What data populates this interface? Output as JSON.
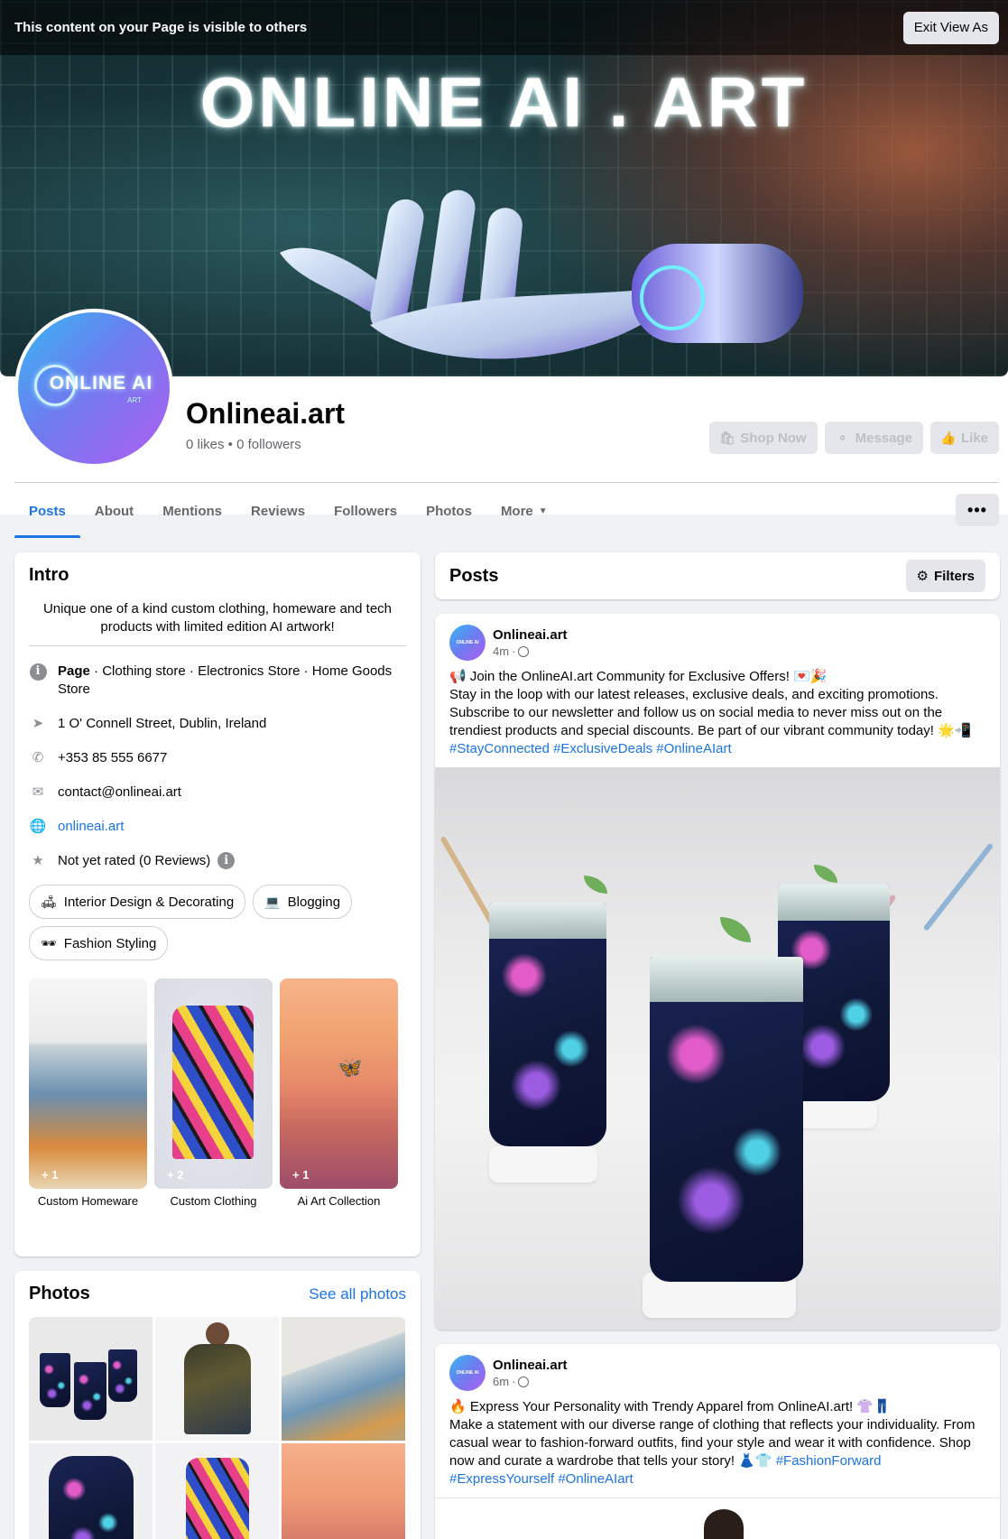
{
  "view_as": {
    "notice": "This content on your Page is visible to others",
    "exit_label": "Exit View As"
  },
  "cover": {
    "logo_text": "ONLINE AI . ART"
  },
  "profile": {
    "avatar_text": "ONLINE AI",
    "avatar_sub": "ART",
    "name": "Onlineai.art",
    "stats": "0 likes • 0 followers",
    "actions": [
      {
        "label": "Shop Now",
        "icon": "bag-icon"
      },
      {
        "label": "Message",
        "icon": "messenger-icon"
      },
      {
        "label": "Like",
        "icon": "thumbs-up-icon"
      }
    ]
  },
  "tabs": [
    {
      "label": "Posts",
      "active": true
    },
    {
      "label": "About"
    },
    {
      "label": "Mentions"
    },
    {
      "label": "Reviews"
    },
    {
      "label": "Followers"
    },
    {
      "label": "Photos"
    },
    {
      "label": "More"
    }
  ],
  "more_menu_label": "•••",
  "intro": {
    "title": "Intro",
    "bio": "Unique one of a kind custom clothing, homeware and tech products with limited edition AI artwork!",
    "page_label": "Page",
    "categories": " · Clothing store · Electronics Store · Home Goods Store",
    "address": "1 O' Connell Street, Dublin, Ireland",
    "phone": "+353 85 555 6677",
    "email": "contact@onlineai.art",
    "website": "onlineai.art",
    "rating": "Not yet rated (0 Reviews)",
    "interests": [
      {
        "label": "Interior Design & Decorating",
        "icon": "sofa-icon"
      },
      {
        "label": "Blogging",
        "icon": "laptop-icon"
      },
      {
        "label": "Fashion Styling",
        "icon": "sunglasses-icon"
      }
    ],
    "featured": [
      {
        "caption": "Custom Homeware",
        "badge": "+ 1"
      },
      {
        "caption": "Custom Clothing",
        "badge": "+ 2"
      },
      {
        "caption": "Ai Art Collection",
        "badge": "+ 1"
      }
    ]
  },
  "photos": {
    "title": "Photos",
    "see_all": "See all photos"
  },
  "posts": {
    "title": "Posts",
    "filters_label": "Filters",
    "items": [
      {
        "author": "Onlineai.art",
        "time": "4m",
        "headline": "📢 Join the OnlineAI.art Community for Exclusive Offers! 💌🎉",
        "body": "Stay in the loop with our latest releases, exclusive deals, and exciting promotions. Subscribe to our newsletter and follow us on social media to never miss out on the trendiest products and special discounts. Be part of our vibrant community today! 🌟📲",
        "hashtags": "#StayConnected #ExclusiveDeals #OnlineAIart"
      },
      {
        "author": "Onlineai.art",
        "time": "6m",
        "headline": "🔥 Express Your Personality with Trendy Apparel from OnlineAI.art! 👚👖",
        "body": "Make a statement with our diverse range of clothing that reflects your individuality. From casual wear to fashion-forward outfits, find your style and wear it with confidence. Shop now and curate a wardrobe that tells your story! 👗👕",
        "hashtags": "#FashionForward #ExpressYourself #OnlineAIart"
      }
    ]
  }
}
